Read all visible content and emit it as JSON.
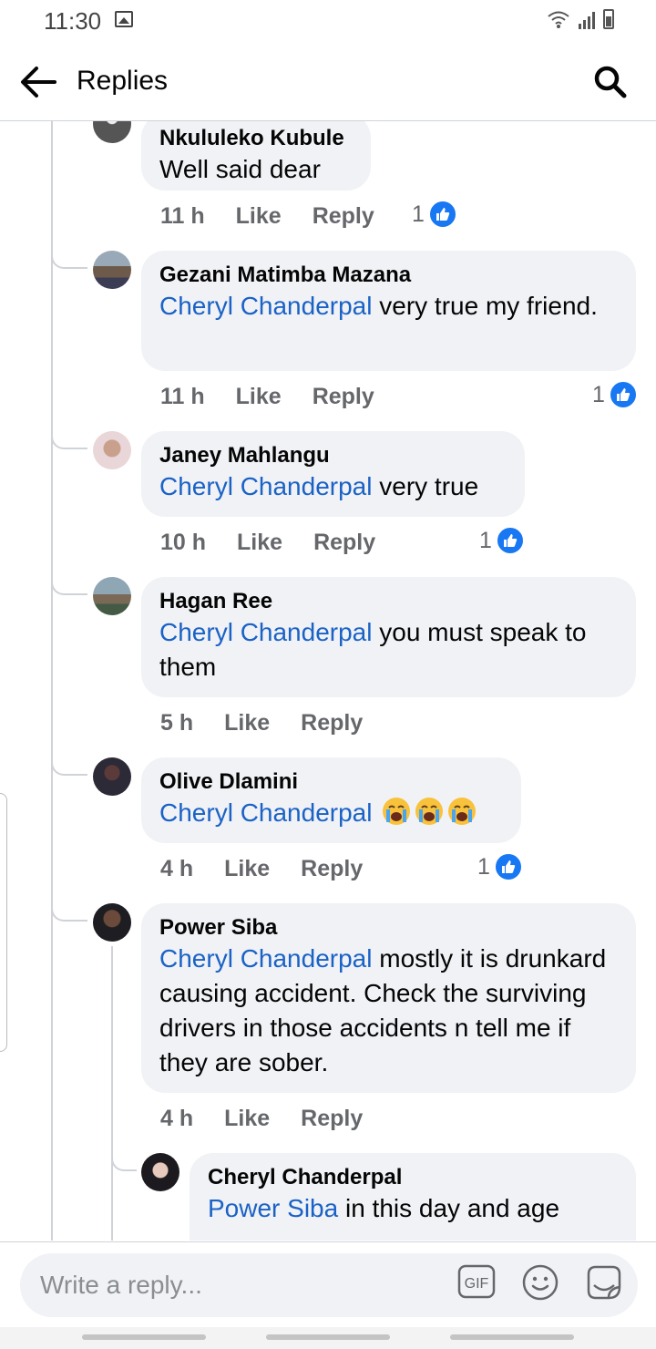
{
  "status_bar": {
    "time": "11:30"
  },
  "header": {
    "title": "Replies"
  },
  "comments": [
    {
      "author": "Nkululeko Kubule",
      "mention": "",
      "text": "Well said dear",
      "time": "11 h",
      "like": "Like",
      "reply": "Reply",
      "reaction_count": "1"
    },
    {
      "author": "Gezani Matimba Mazana",
      "mention": "Cheryl Chanderpal",
      "text": " very true my friend.",
      "time": "11 h",
      "like": "Like",
      "reply": "Reply",
      "reaction_count": "1"
    },
    {
      "author": "Janey Mahlangu",
      "mention": "Cheryl Chanderpal",
      "text": " very true",
      "time": "10 h",
      "like": "Like",
      "reply": "Reply",
      "reaction_count": "1"
    },
    {
      "author": "Hagan Ree",
      "mention": "Cheryl Chanderpal",
      "text": " you must speak to them",
      "time": "5 h",
      "like": "Like",
      "reply": "Reply",
      "reaction_count": ""
    },
    {
      "author": "Olive Dlamini",
      "mention": "Cheryl Chanderpal",
      "text": "",
      "time": "4 h",
      "like": "Like",
      "reply": "Reply",
      "reaction_count": "1"
    },
    {
      "author": "Power Siba",
      "mention": "Cheryl Chanderpal",
      "text": " mostly it is drunkard causing accident.  Check the surviving drivers in those accidents n tell me if they are sober.",
      "time": "4 h",
      "like": "Like",
      "reply": "Reply",
      "reaction_count": ""
    },
    {
      "author": "Cheryl Chanderpal",
      "mention": "Power Siba",
      "text": " in this day and age",
      "time": "",
      "like": "",
      "reply": "",
      "reaction_count": ""
    }
  ],
  "composer": {
    "placeholder": "Write a reply..."
  },
  "colors": {
    "mention": "#1b62c6",
    "like_badge": "#1877f2",
    "bubble": "#f0f2f5",
    "meta": "#65676b"
  }
}
